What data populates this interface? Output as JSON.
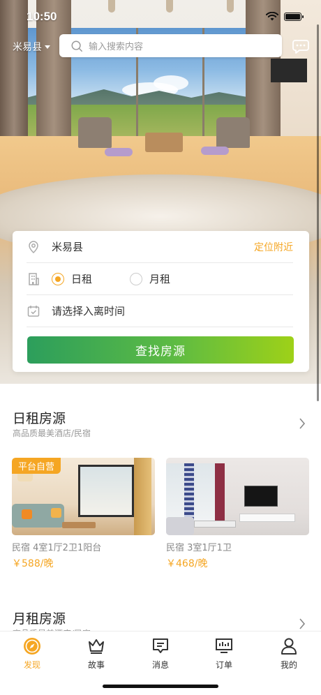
{
  "status_bar": {
    "time": "10:50"
  },
  "header": {
    "city": "米易县",
    "search_placeholder": "输入搜索内容"
  },
  "search_card": {
    "location": "米易县",
    "locate_label": "定位附近",
    "rental_types": [
      {
        "label": "日租",
        "selected": true
      },
      {
        "label": "月租",
        "selected": false
      }
    ],
    "date_placeholder": "请选择入离时间",
    "find_button": "查找房源"
  },
  "daily_section": {
    "title": "日租房源",
    "subtitle": "高品质最美酒店/民宿",
    "listings": [
      {
        "badge": "平台自营",
        "description": "民宿 4室1厅2卫1阳台",
        "price": "￥588/晚"
      },
      {
        "badge": "",
        "description": "民宿 3室1厅1卫",
        "price": "￥468/晚"
      }
    ]
  },
  "monthly_section": {
    "title": "月租房源",
    "subtitle": "高品质最美酒店/民宿"
  },
  "tab_bar": {
    "active": "发现",
    "tabs": [
      {
        "label": "发现",
        "icon": "compass-icon"
      },
      {
        "label": "故事",
        "icon": "crown-icon"
      },
      {
        "label": "消息",
        "icon": "message-icon"
      },
      {
        "label": "订单",
        "icon": "order-icon"
      },
      {
        "label": "我的",
        "icon": "person-icon"
      }
    ]
  },
  "colors": {
    "accent": "#f5a623",
    "button_start": "#2c9e5c",
    "button_end": "#9ed118"
  }
}
